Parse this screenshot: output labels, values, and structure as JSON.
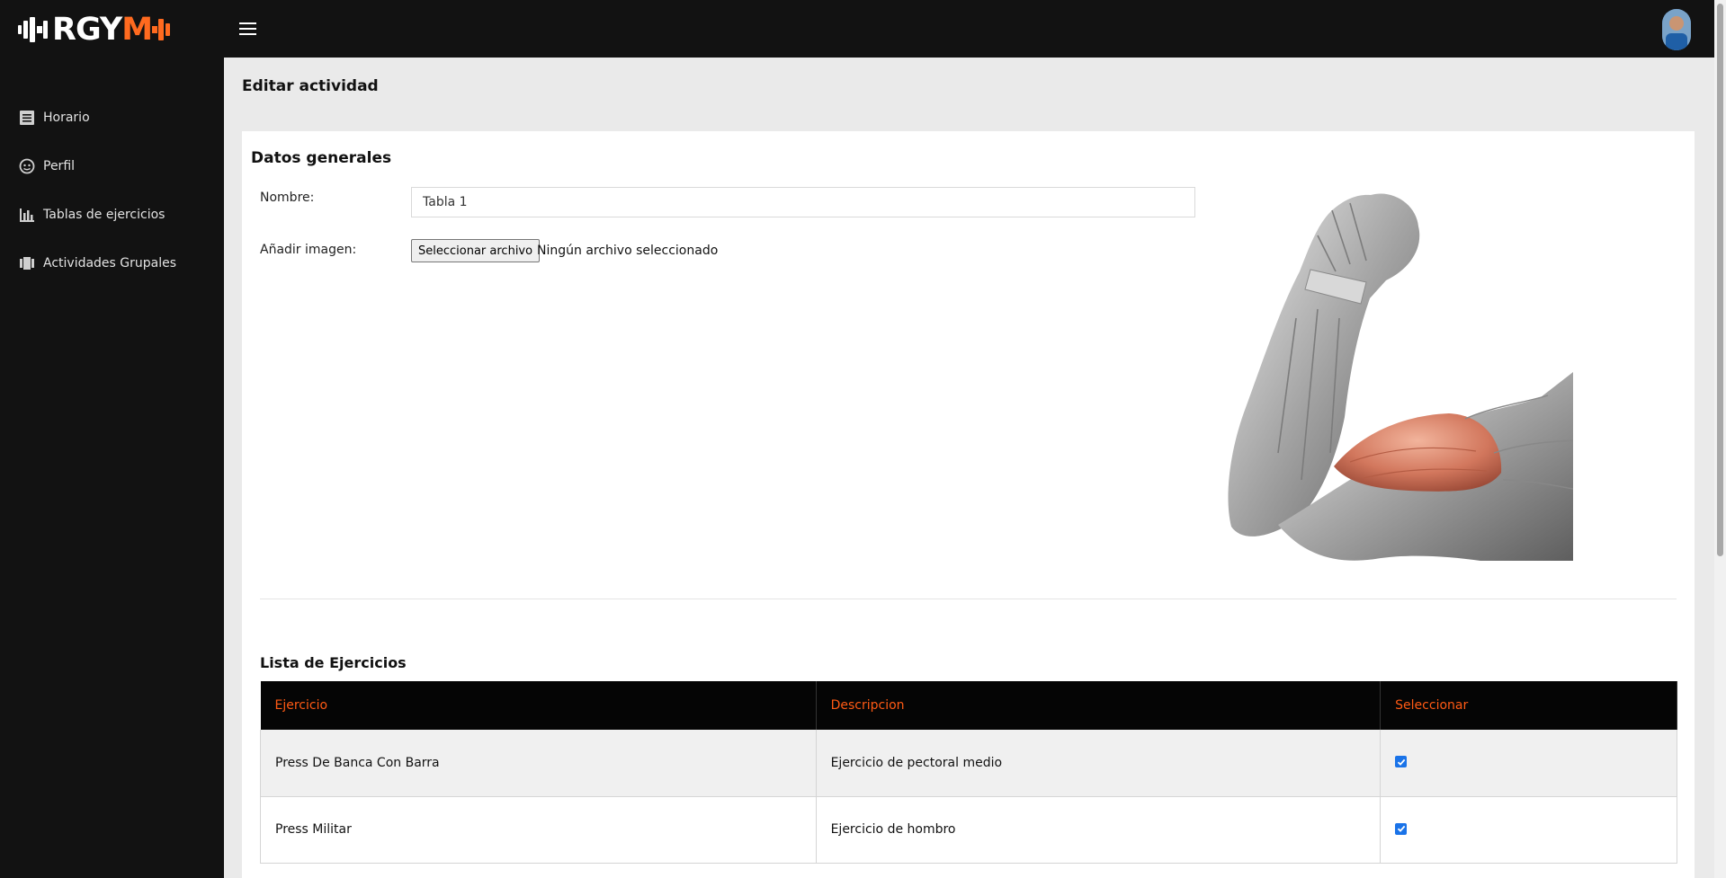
{
  "brand": {
    "logo_main": "RGY",
    "logo_accent": "M",
    "accent_color": "#ff6a1f"
  },
  "header": {
    "menu_icon": "hamburger-icon",
    "avatar": "user-avatar"
  },
  "sidebar": {
    "items": [
      {
        "label": "Horario",
        "icon": "schedule-icon"
      },
      {
        "label": "Perfil",
        "icon": "profile-icon"
      },
      {
        "label": "Tablas de ejercicios",
        "icon": "bar-chart-icon"
      },
      {
        "label": "Actividades Grupales",
        "icon": "group-activity-icon"
      }
    ]
  },
  "page": {
    "title": "Editar actividad",
    "section_title": "Datos generales",
    "name_label": "Nombre:",
    "name_value": "Tabla 1",
    "image_label": "Añadir imagen:",
    "file_button": "Seleccionar archivo",
    "file_status": "Ningún archivo seleccionado",
    "list_title": "Lista de Ejercicios"
  },
  "table": {
    "headers": [
      "Ejercicio",
      "Descripcion",
      "Seleccionar"
    ],
    "header_color": "#ff5a14",
    "rows": [
      {
        "exercise": "Press De Banca Con Barra",
        "description": "Ejercicio de pectoral medio",
        "selected": true
      },
      {
        "exercise": "Press Militar",
        "description": "Ejercicio de hombro",
        "selected": true
      }
    ]
  }
}
